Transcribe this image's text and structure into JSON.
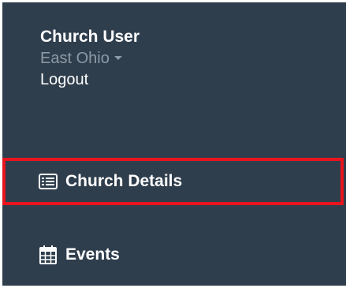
{
  "user": {
    "name": "Church User",
    "region": "East Ohio",
    "logout": "Logout"
  },
  "nav": {
    "items": [
      {
        "label": "Church Details",
        "icon": "list-icon",
        "highlighted": true
      },
      {
        "label": "Events",
        "icon": "calendar-icon",
        "highlighted": false
      }
    ]
  },
  "colors": {
    "sidebar_bg": "#2f3e4d",
    "highlight": "#e8141e",
    "muted_text": "#8d9aa6"
  }
}
